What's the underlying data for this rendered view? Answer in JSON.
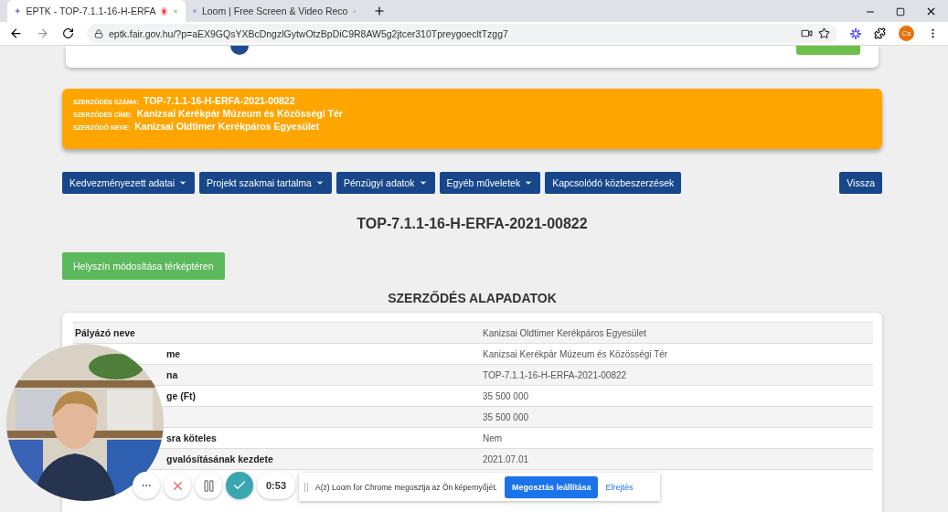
{
  "browser": {
    "tabs": [
      {
        "title": "EPTK - TOP-7.1.1-16-H-ERFA",
        "selected": true,
        "recording": true,
        "kind": "eptk"
      },
      {
        "title": "Loom | Free Screen & Video Reco",
        "selected": false,
        "recording": false,
        "kind": "loom"
      }
    ],
    "url": "eptk.fair.gov.hu/?p=aEX9GQsYXBcDngzlGytwOtzBpDiC9R8AW5g2jtcer310TpreygoecltTzgg7",
    "profile_initials": "Cs"
  },
  "banner": [
    {
      "label": "SZERZŐDÉS SZÁMA:",
      "value": "TOP-7.1.1-16-H-ERFA-2021-00822"
    },
    {
      "label": "SZERZŐDÉS CÍME:",
      "value": "Kanizsai Kerékpár Múzeum és Közösségi Tér"
    },
    {
      "label": "SZERZŐDŐ NEVE:",
      "value": "Kanizsai Oldtimer Kerékpáros Egyesület"
    }
  ],
  "menu": [
    {
      "label": "Kedvezményezett adatai",
      "dropdown": true
    },
    {
      "label": "Projekt szakmai tartalma",
      "dropdown": true
    },
    {
      "label": "Pénzügyi adatok",
      "dropdown": true
    },
    {
      "label": "Egyéb műveletek",
      "dropdown": true
    },
    {
      "label": "Kapcsolódó közbeszerzések",
      "dropdown": false
    }
  ],
  "back_button": "Vissza",
  "title": "TOP-7.1.1-16-H-ERFA-2021-00822",
  "map_button": "Helyszín módosítása térképtéren",
  "section_title": "SZERZŐDÉS ALAPADATOK",
  "rows": [
    {
      "label": "Pályázó neve",
      "value": "Kanizsai Oldtimer Kerékpáros Egyesület"
    },
    {
      "label": "me",
      "covered": true,
      "value": "Kanizsai Kerékpár Múzeum és Közösségi Tér"
    },
    {
      "label": "na",
      "covered": true,
      "value": "TOP-7.1.1-16-H-ERFA-2021-00822"
    },
    {
      "label": "ge (Ft)",
      "covered": true,
      "value": "35 500 000"
    },
    {
      "value": "35 500 000"
    },
    {
      "label": "sra köteles",
      "covered": true,
      "value": "Nem"
    },
    {
      "label": "gvalósításának kezdete",
      "covered": true,
      "value": "2021.07.01"
    },
    {}
  ],
  "recorder": {
    "timer": "0:53",
    "notice": "A(z) Loom for Chrome megosztja az Ön képernyőjét.",
    "stop_button": "Megosztás leállítása",
    "hide_link": "Elrejtés"
  }
}
